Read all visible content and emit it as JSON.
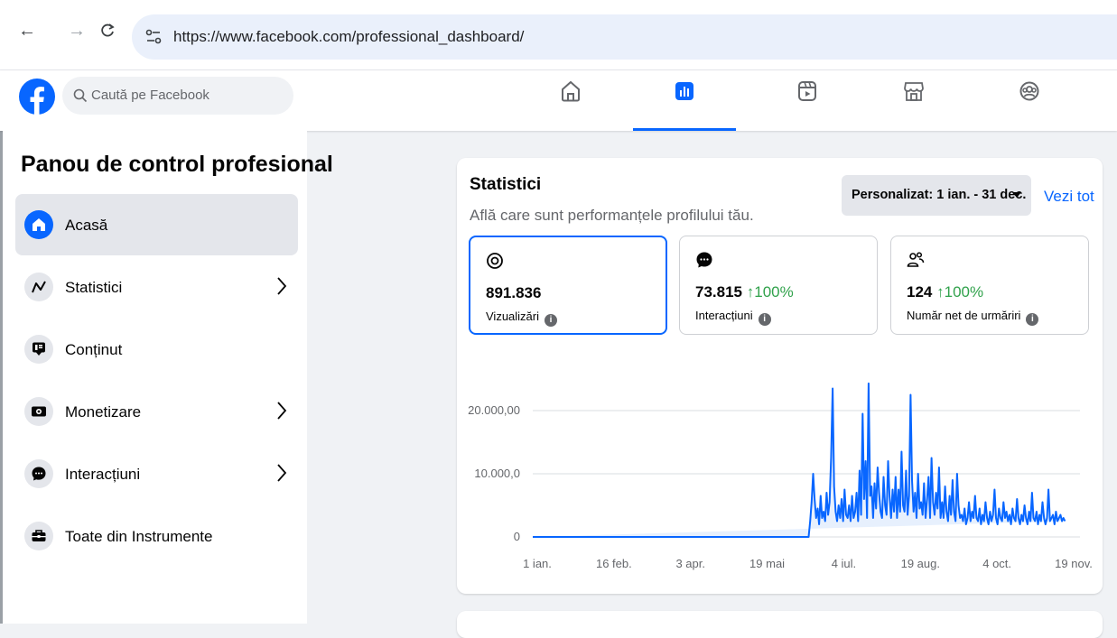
{
  "browser": {
    "url": "https://www.facebook.com/professional_dashboard/"
  },
  "header": {
    "search_placeholder": "Caută pe Facebook",
    "tabs": [
      {
        "icon": "home-icon",
        "active": false
      },
      {
        "icon": "dashboard-icon",
        "active": true
      },
      {
        "icon": "video-icon",
        "active": false
      },
      {
        "icon": "marketplace-icon",
        "active": false
      },
      {
        "icon": "groups-icon",
        "active": false
      }
    ]
  },
  "sidebar": {
    "title": "Panou de control profesional",
    "items": [
      {
        "label": "Acasă",
        "icon": "home-icon",
        "active": true,
        "chevron": false
      },
      {
        "label": "Statistici",
        "icon": "insights-icon",
        "active": false,
        "chevron": true
      },
      {
        "label": "Conținut",
        "icon": "content-icon",
        "active": false,
        "chevron": false
      },
      {
        "label": "Monetizare",
        "icon": "money-icon",
        "active": false,
        "chevron": true
      },
      {
        "label": "Interacțiuni",
        "icon": "chat-icon",
        "active": false,
        "chevron": true
      },
      {
        "label": "Toate din Instrumente",
        "icon": "toolbox-icon",
        "active": false,
        "chevron": false
      }
    ]
  },
  "insights": {
    "title": "Statistici",
    "subtitle": "Află care sunt performanțele profilului tău.",
    "date_range": "Personalizat: 1 ian. - 31 dec.",
    "see_all": "Vezi tot",
    "metrics": [
      {
        "value": "891.836",
        "delta": "",
        "label": "Vizualizări",
        "icon": "eye-icon",
        "selected": true
      },
      {
        "value": "73.815",
        "delta": "↑100%",
        "label": "Interacțiuni",
        "icon": "chat-bubble-icon",
        "selected": false
      },
      {
        "value": "124",
        "delta": "↑100%",
        "label": "Număr net de urmăriri",
        "icon": "followers-icon",
        "selected": false
      }
    ]
  },
  "chart_data": {
    "type": "area",
    "title": "",
    "xlabel": "",
    "ylabel": "",
    "ylim": [
      0,
      25000
    ],
    "y_ticks": [
      "0",
      "10.000,0",
      "20.000,00"
    ],
    "y_tick_values": [
      0,
      10000,
      20000
    ],
    "x_ticks": [
      "1 ian.",
      "16 feb.",
      "3 apr.",
      "19 mai",
      "4 iul.",
      "19 aug.",
      "4 oct.",
      "19 nov."
    ],
    "grid": true,
    "color": "#0866ff",
    "fill": "#e7f0fd",
    "x": [
      0,
      46,
      92,
      138,
      184,
      185,
      186,
      187,
      188,
      189,
      190,
      191,
      192,
      193,
      194,
      195,
      196,
      197,
      198,
      199,
      200,
      201,
      202,
      203,
      204,
      205,
      206,
      207,
      208,
      209,
      210,
      211,
      212,
      213,
      214,
      215,
      216,
      217,
      218,
      219,
      220,
      221,
      222,
      223,
      224,
      225,
      226,
      227,
      228,
      229,
      230,
      231,
      232,
      233,
      234,
      235,
      236,
      237,
      238,
      239,
      240,
      241,
      242,
      243,
      244,
      245,
      246,
      247,
      248,
      249,
      250,
      251,
      252,
      253,
      254,
      255,
      256,
      257,
      258,
      259,
      260,
      261,
      262,
      263,
      264,
      265,
      266,
      267,
      268,
      269,
      270,
      271,
      272,
      273,
      274,
      275,
      276,
      277,
      278,
      279,
      280,
      281,
      282,
      283,
      284,
      285,
      286,
      287,
      288,
      289,
      290,
      291,
      292,
      293,
      294,
      295,
      296,
      297,
      298,
      299,
      300,
      301,
      302,
      303,
      304,
      305,
      306,
      307,
      308,
      309,
      310,
      311,
      312,
      313,
      314,
      315,
      316,
      317,
      318,
      319,
      320,
      321,
      322,
      323,
      324,
      325,
      326,
      327,
      328,
      329,
      330,
      331,
      332,
      333,
      334,
      335,
      336,
      337,
      338,
      339,
      340,
      341,
      342,
      343,
      344,
      345,
      346,
      347,
      348,
      349,
      350,
      351,
      352,
      353,
      354,
      355,
      356,
      357,
      358,
      359,
      360,
      361,
      362,
      363,
      364,
      365
    ],
    "values": [
      0,
      0,
      0,
      0,
      0,
      2500,
      5500,
      10000,
      6000,
      3000,
      4500,
      2000,
      6500,
      3000,
      4000,
      2500,
      7000,
      3500,
      5500,
      12500,
      23500,
      8000,
      4000,
      2500,
      5000,
      3000,
      6000,
      2500,
      7500,
      3500,
      3000,
      5000,
      2500,
      6500,
      3000,
      4000,
      7000,
      2500,
      10500,
      3500,
      19500,
      6000,
      12000,
      3000,
      24300,
      6500,
      8000,
      3000,
      8500,
      4500,
      11000,
      7000,
      4000,
      3000,
      9500,
      5000,
      3500,
      12000,
      6500,
      3000,
      7500,
      4000,
      9500,
      3000,
      7500,
      4000,
      13500,
      5000,
      4000,
      10500,
      3500,
      6500,
      22500,
      9000,
      4000,
      7000,
      3000,
      10000,
      4500,
      5500,
      3500,
      8500,
      3000,
      6000,
      9500,
      3000,
      12500,
      5500,
      3500,
      7000,
      4500,
      11000,
      3000,
      5500,
      3000,
      8000,
      4000,
      2500,
      6500,
      3500,
      9000,
      4000,
      2500,
      10000,
      5000,
      3000,
      3500,
      2500,
      4500,
      2000,
      3000,
      5500,
      2500,
      4000,
      3000,
      6500,
      3000,
      2500,
      4500,
      2000,
      3500,
      2500,
      5500,
      3000,
      2000,
      4000,
      2500,
      3500,
      7500,
      3000,
      2000,
      4500,
      3000,
      2500,
      5500,
      3000,
      4000,
      2500,
      3500,
      2000,
      4500,
      3000,
      2500,
      6000,
      3000,
      2000,
      3500,
      2500,
      5000,
      3000,
      2000,
      4000,
      2500,
      7000,
      3000,
      2500,
      4000,
      2000,
      3500,
      2500,
      5500,
      3000,
      2000,
      3000,
      7500,
      2500,
      3000,
      3500,
      2000,
      4000,
      2500,
      3000,
      3500,
      2500,
      3000,
      2500
    ]
  }
}
